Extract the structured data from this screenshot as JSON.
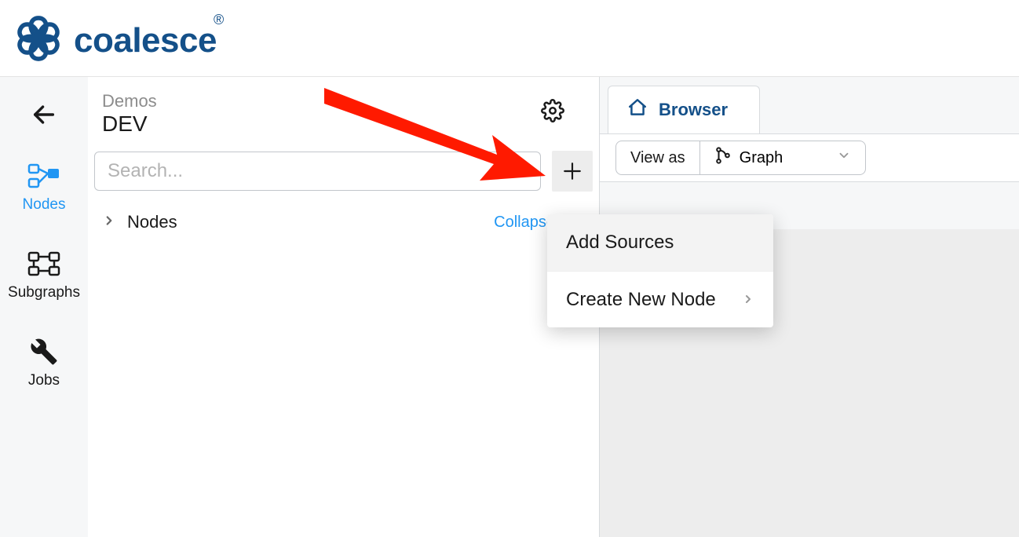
{
  "brand": {
    "name": "coalesce"
  },
  "breadcrumb": {
    "project": "Demos",
    "environment": "DEV"
  },
  "rail": {
    "items": [
      {
        "label": "Nodes",
        "active": true
      },
      {
        "label": "Subgraphs",
        "active": false
      },
      {
        "label": "Jobs",
        "active": false
      }
    ]
  },
  "panel": {
    "search_placeholder": "Search...",
    "section_label": "Nodes",
    "collapse_label": "Collapse"
  },
  "browser": {
    "tab_label": "Browser",
    "viewas_label": "View as",
    "viewas_value": "Graph"
  },
  "menu": {
    "items": [
      {
        "label": "Add Sources",
        "has_submenu": false
      },
      {
        "label": "Create New Node",
        "has_submenu": true
      }
    ]
  }
}
